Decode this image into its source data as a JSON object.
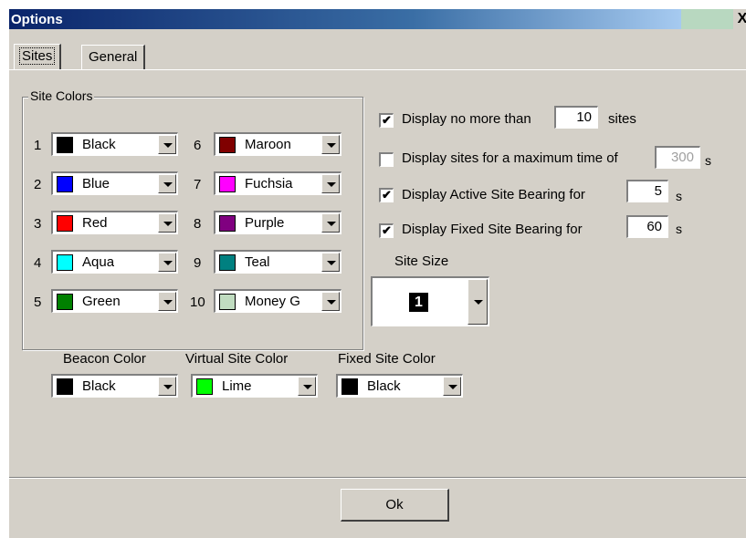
{
  "window": {
    "title": "Options",
    "close_label": "X"
  },
  "tabs": [
    {
      "label": "Sites"
    },
    {
      "label": "General"
    }
  ],
  "site_colors": {
    "legend": "Site Colors",
    "items": [
      {
        "num": "1",
        "name": "Black",
        "color": "#000000"
      },
      {
        "num": "2",
        "name": "Blue",
        "color": "#0000ff"
      },
      {
        "num": "3",
        "name": "Red",
        "color": "#ff0000"
      },
      {
        "num": "4",
        "name": "Aqua",
        "color": "#00ffff"
      },
      {
        "num": "5",
        "name": "Green",
        "color": "#008000"
      },
      {
        "num": "6",
        "name": "Maroon",
        "color": "#800000"
      },
      {
        "num": "7",
        "name": "Fuchsia",
        "color": "#ff00ff"
      },
      {
        "num": "8",
        "name": "Purple",
        "color": "#800080"
      },
      {
        "num": "9",
        "name": "Teal",
        "color": "#008080"
      },
      {
        "num": "10",
        "name": "Money G",
        "color": "#c0dcc0"
      }
    ]
  },
  "options": {
    "max_sites": {
      "checked": true,
      "label": "Display no more than",
      "value": "10",
      "unit": "sites"
    },
    "max_time": {
      "checked": false,
      "label": "Display sites for a maximum time of",
      "value": "300",
      "unit": "s"
    },
    "active_bearing": {
      "checked": true,
      "label": "Display Active Site Bearing for",
      "value": "5",
      "unit": "s"
    },
    "fixed_bearing": {
      "checked": true,
      "label": "Display Fixed Site Bearing for",
      "value": "60",
      "unit": "s"
    }
  },
  "site_size": {
    "label": "Site Size",
    "value": "1"
  },
  "beacon_color": {
    "label": "Beacon Color",
    "name": "Black",
    "color": "#000000"
  },
  "virtual_site_color": {
    "label": "Virtual Site Color",
    "name": "Lime",
    "color": "#00ff00"
  },
  "fixed_site_color": {
    "label": "Fixed Site Color",
    "name": "Black",
    "color": "#000000"
  },
  "ok_label": "Ok"
}
